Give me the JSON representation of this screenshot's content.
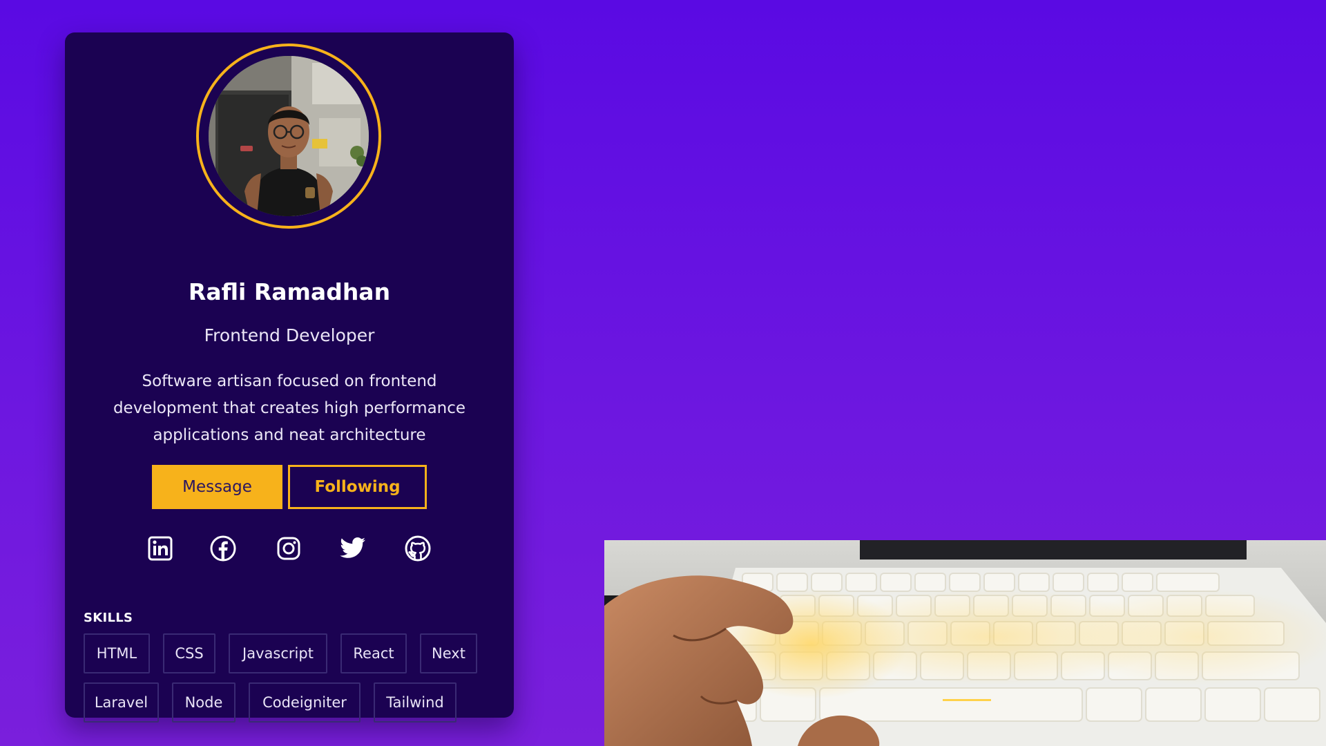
{
  "profile": {
    "name": "Rafli Ramadhan",
    "role": "Frontend Developer",
    "bio": "Software artisan focused on frontend development that creates high performance applications and neat architecture",
    "avatar_alt": "profile-photo"
  },
  "actions": {
    "message_label": "Message",
    "following_label": "Following"
  },
  "socials": [
    {
      "name": "linkedin",
      "icon": "linkedin-icon"
    },
    {
      "name": "facebook",
      "icon": "facebook-icon"
    },
    {
      "name": "instagram",
      "icon": "instagram-icon"
    },
    {
      "name": "twitter",
      "icon": "twitter-icon"
    },
    {
      "name": "github",
      "icon": "github-icon"
    }
  ],
  "skills": {
    "title": "SKILLS",
    "items": [
      "HTML",
      "CSS",
      "Javascript",
      "React",
      "Next",
      "Laravel",
      "Node",
      "Codeigniter",
      "Tailwind"
    ]
  },
  "colors": {
    "background_top": "#5a0ae3",
    "background_bottom": "#7a1fdc",
    "card": "#1b0252",
    "accent": "#f7b21b",
    "text": "#ffffff",
    "skill_border": "#3a2a74"
  },
  "media": {
    "photo_subject": "hand-on-backlit-keyboard"
  }
}
